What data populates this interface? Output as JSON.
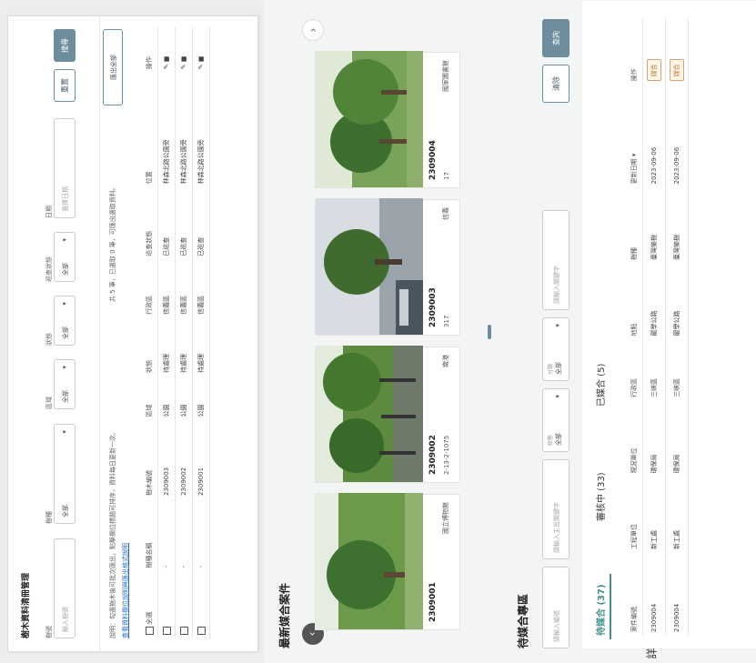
{
  "left": {
    "title": "樹木資料清冊管理",
    "filters": [
      {
        "label": "樹號",
        "placeholder": "輸入樹號"
      },
      {
        "label": "樹種",
        "value": "全部"
      },
      {
        "label": "區域",
        "value": "全部"
      },
      {
        "label": "狀態",
        "value": "全部"
      },
      {
        "label": "巡查狀態",
        "value": "全部"
      },
      {
        "label": "日期",
        "placeholder": "選擇日期"
      }
    ],
    "reset_label": "重置",
    "search_label": "搜尋",
    "notice": "說明：勾選樹木後可批次匯出，點擊欄位標題可排序，資料每日更新一次。",
    "notice_link": "查看資料欄位說明與匯出格式說明",
    "toolbar_note": "共 5 筆，已選取 0 筆，可匯出選取資料。",
    "export_label": "匯出全部",
    "columns": [
      "全選",
      "樹種名稱",
      "樹木編號",
      "區域",
      "狀態",
      "行政區",
      "巡查狀態",
      "位置",
      "操作"
    ],
    "rows": [
      {
        "species": "-",
        "id": "2309003",
        "area": "公園",
        "status": "待處理",
        "district": "信義區",
        "patrol": "已巡查",
        "loc": "林森北路公園旁"
      },
      {
        "species": "-",
        "id": "2309002",
        "area": "公園",
        "status": "待處理",
        "district": "信義區",
        "patrol": "已巡查",
        "loc": "林森北路公園旁"
      },
      {
        "species": "-",
        "id": "2309001",
        "area": "公園",
        "status": "待處理",
        "district": "信義區",
        "patrol": "已巡查",
        "loc": "林森北路公園旁"
      }
    ]
  },
  "right": {
    "recent_title": "最新媒合案件",
    "cards": [
      {
        "num": "2309004",
        "sub": "17",
        "loc": "國家圖書館"
      },
      {
        "num": "2309003",
        "sub": "317",
        "loc": "信義"
      },
      {
        "num": "2309002",
        "sub": "2-13-2-1075",
        "loc": "南港"
      },
      {
        "num": "2309001",
        "sub": "",
        "loc": "國立博物館"
      }
    ],
    "pending_title": "待媒合專區",
    "search_filters": [
      {
        "placeholder": "請輸入編號"
      },
      {
        "placeholder": "請輸入主旨關鍵字"
      },
      {
        "label": "狀態",
        "value": "全部"
      },
      {
        "label": "分類",
        "value": "全部"
      },
      {
        "placeholder": "請輸入關鍵字"
      }
    ],
    "clear_label": "清除",
    "query_label": "查詢",
    "tabs": [
      "待媒合 (37)",
      "審核中 (33)",
      "已媒合 (5)"
    ],
    "table_cols": [
      "案件編號",
      "工程單位",
      "現況單位",
      "行政區",
      "地點",
      "樹種",
      "更新日期 ▾",
      "操作"
    ],
    "table_rows": [
      {
        "id": "2309004",
        "unit": "新工處",
        "cur": "環保局",
        "dist": "三峽區",
        "place": "龍學公路",
        "tree": "臺灣欒樹",
        "date": "2023-09-06",
        "op": "媒合"
      },
      {
        "id": "2309004",
        "unit": "新工處",
        "cur": "環保局",
        "dist": "三峽區",
        "place": "龍學公路",
        "tree": "臺灣欒樹",
        "date": "2023-09-06",
        "op": "媒合"
      }
    ],
    "footer_fragment": "詳"
  },
  "colors": {
    "accent": "#3f8f8a",
    "button": "#6b8d9c",
    "badge": "#c77a2a"
  }
}
